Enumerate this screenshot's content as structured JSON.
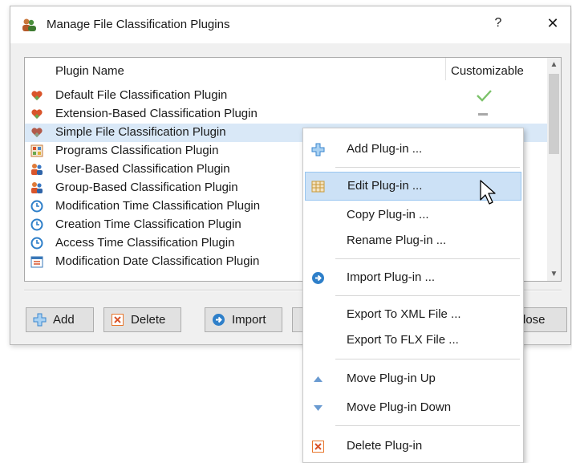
{
  "window": {
    "title": "Manage File Classification Plugins",
    "help_glyph": "?",
    "close_glyph": "✕"
  },
  "list": {
    "col_name": "Plugin Name",
    "col_customizable": "Customizable",
    "rows": [
      {
        "name": "Default File Classification Plugin",
        "icon": "heart-puzzle-icon",
        "customizable": "check"
      },
      {
        "name": "Extension-Based Classification Plugin",
        "icon": "heart-puzzle-icon",
        "customizable": "dash"
      },
      {
        "name": "Simple File Classification Plugin",
        "icon": "heart-puzzle-icon",
        "customizable": ""
      },
      {
        "name": "Programs Classification Plugin",
        "icon": "programs-grid-icon",
        "customizable": ""
      },
      {
        "name": "User-Based Classification Plugin",
        "icon": "users-icon",
        "customizable": ""
      },
      {
        "name": "Group-Based Classification Plugin",
        "icon": "users-icon",
        "customizable": ""
      },
      {
        "name": "Modification Time Classification Plugin",
        "icon": "clock-icon",
        "customizable": ""
      },
      {
        "name": "Creation Time Classification Plugin",
        "icon": "clock-icon",
        "customizable": ""
      },
      {
        "name": "Access Time Classification Plugin",
        "icon": "clock-icon",
        "customizable": ""
      },
      {
        "name": "Modification Date Classification Plugin",
        "icon": "calendar-icon",
        "customizable": ""
      }
    ]
  },
  "buttons": {
    "add": "Add",
    "delete": "Delete",
    "import": "Import",
    "close": "lose"
  },
  "context_menu": {
    "add": "Add Plug-in ...",
    "edit": "Edit Plug-in ...",
    "copy": "Copy Plug-in ...",
    "rename": "Rename Plug-in ...",
    "import": "Import Plug-in ...",
    "export_xml": "Export To XML File ...",
    "export_flx": "Export To FLX File ...",
    "move_up": "Move Plug-in Up",
    "move_down": "Move Plug-in Down",
    "delete": "Delete Plug-in"
  },
  "colors": {
    "selection": "#d9e8f7",
    "menu_highlight": "#cce1f6",
    "accent_blue": "#2e7fc9",
    "delete_orange": "#e8762b"
  }
}
